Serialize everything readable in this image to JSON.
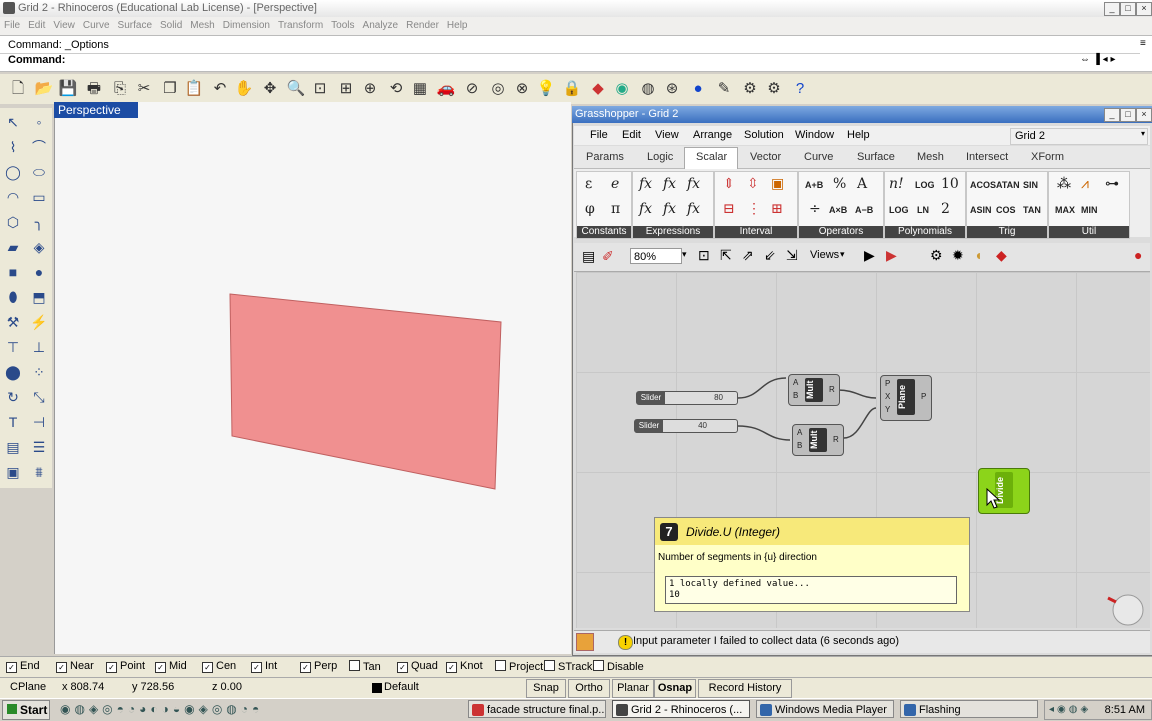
{
  "window": {
    "title": "Grid 2 - Rhinoceros (Educational Lab License) - [Perspective]"
  },
  "menu": [
    "File",
    "Edit",
    "View",
    "Curve",
    "Surface",
    "Solid",
    "Mesh",
    "Dimension",
    "Transform",
    "Tools",
    "Analyze",
    "Render",
    "Help"
  ],
  "command": {
    "history": "Command: _Options",
    "prompt": "Command:"
  },
  "viewport": {
    "label": "Perspective",
    "surface_color": "#f09090"
  },
  "grasshopper": {
    "title": "Grasshopper - Grid 2",
    "menu": [
      "File",
      "Edit",
      "View",
      "Arrange",
      "Solution",
      "Window",
      "Help"
    ],
    "doc_selector": "Grid 2",
    "tabs": [
      "Params",
      "Logic",
      "Scalar",
      "Vector",
      "Curve",
      "Surface",
      "Mesh",
      "Intersect",
      "XForm"
    ],
    "active_tab": "Scalar",
    "panels": [
      "Constants",
      "Expressions",
      "Interval",
      "Operators",
      "Polynomials",
      "Trig",
      "Util"
    ],
    "panel_symbols": {
      "constants": [
        "ε",
        "e",
        "φ",
        "π"
      ],
      "expressions": [
        "fx",
        "fx",
        "fx",
        "fx",
        "fx",
        "fx"
      ],
      "operators": [
        "A+B",
        "%",
        "A",
        "A×B",
        "A−B"
      ],
      "polynomials": [
        "n!",
        "LOG",
        "10",
        "LOG",
        "LN",
        "2"
      ],
      "trig": [
        "ACOS",
        "ATAN",
        "SIN",
        "ASIN",
        "COS",
        "TAN",
        "MAX",
        "MIN"
      ]
    },
    "zoom": "80%",
    "views_label": "Views",
    "components": {
      "slider1": {
        "label": "Slider",
        "value": "80"
      },
      "slider2": {
        "label": "Slider",
        "value": "40"
      },
      "mult1": {
        "name": "Mult",
        "in": [
          "A",
          "B"
        ],
        "out": "R"
      },
      "mult2": {
        "name": "Mult",
        "in": [
          "A",
          "B"
        ],
        "out": "R"
      },
      "plane": {
        "name": "Plane",
        "in": [
          "P",
          "X",
          "Y"
        ],
        "out": "P"
      },
      "divide": {
        "name": "Divide"
      }
    },
    "tooltip": {
      "title": "Divide.U (Integer)",
      "description": "Number of segments in {u} direction",
      "line1": "1 locally defined value...",
      "line2": "10"
    },
    "status": "Input parameter I failed to collect data (6 seconds ago)"
  },
  "osnap": [
    {
      "label": "End",
      "checked": true
    },
    {
      "label": "Near",
      "checked": true
    },
    {
      "label": "Point",
      "checked": true
    },
    {
      "label": "Mid",
      "checked": true
    },
    {
      "label": "Cen",
      "checked": true
    },
    {
      "label": "Int",
      "checked": true
    },
    {
      "label": "Perp",
      "checked": true
    },
    {
      "label": "Tan",
      "checked": false
    },
    {
      "label": "Quad",
      "checked": true
    },
    {
      "label": "Knot",
      "checked": true
    },
    {
      "label": "Project",
      "checked": false
    },
    {
      "label": "STrack",
      "checked": false
    },
    {
      "label": "Disable",
      "checked": false
    }
  ],
  "status": {
    "cplane": "CPlane",
    "x": "x 808.74",
    "y": "y 728.56",
    "z": "z 0.00",
    "layer": "Default",
    "buttons": [
      "Snap",
      "Ortho",
      "Planar",
      "Osnap",
      "Record History"
    ]
  },
  "taskbar": {
    "start": "Start",
    "tasks": [
      "facade structure final.p...",
      "Grid 2 - Rhinoceros (...",
      "Windows Media Player",
      "Flashing"
    ],
    "clock": "8:51 AM"
  }
}
